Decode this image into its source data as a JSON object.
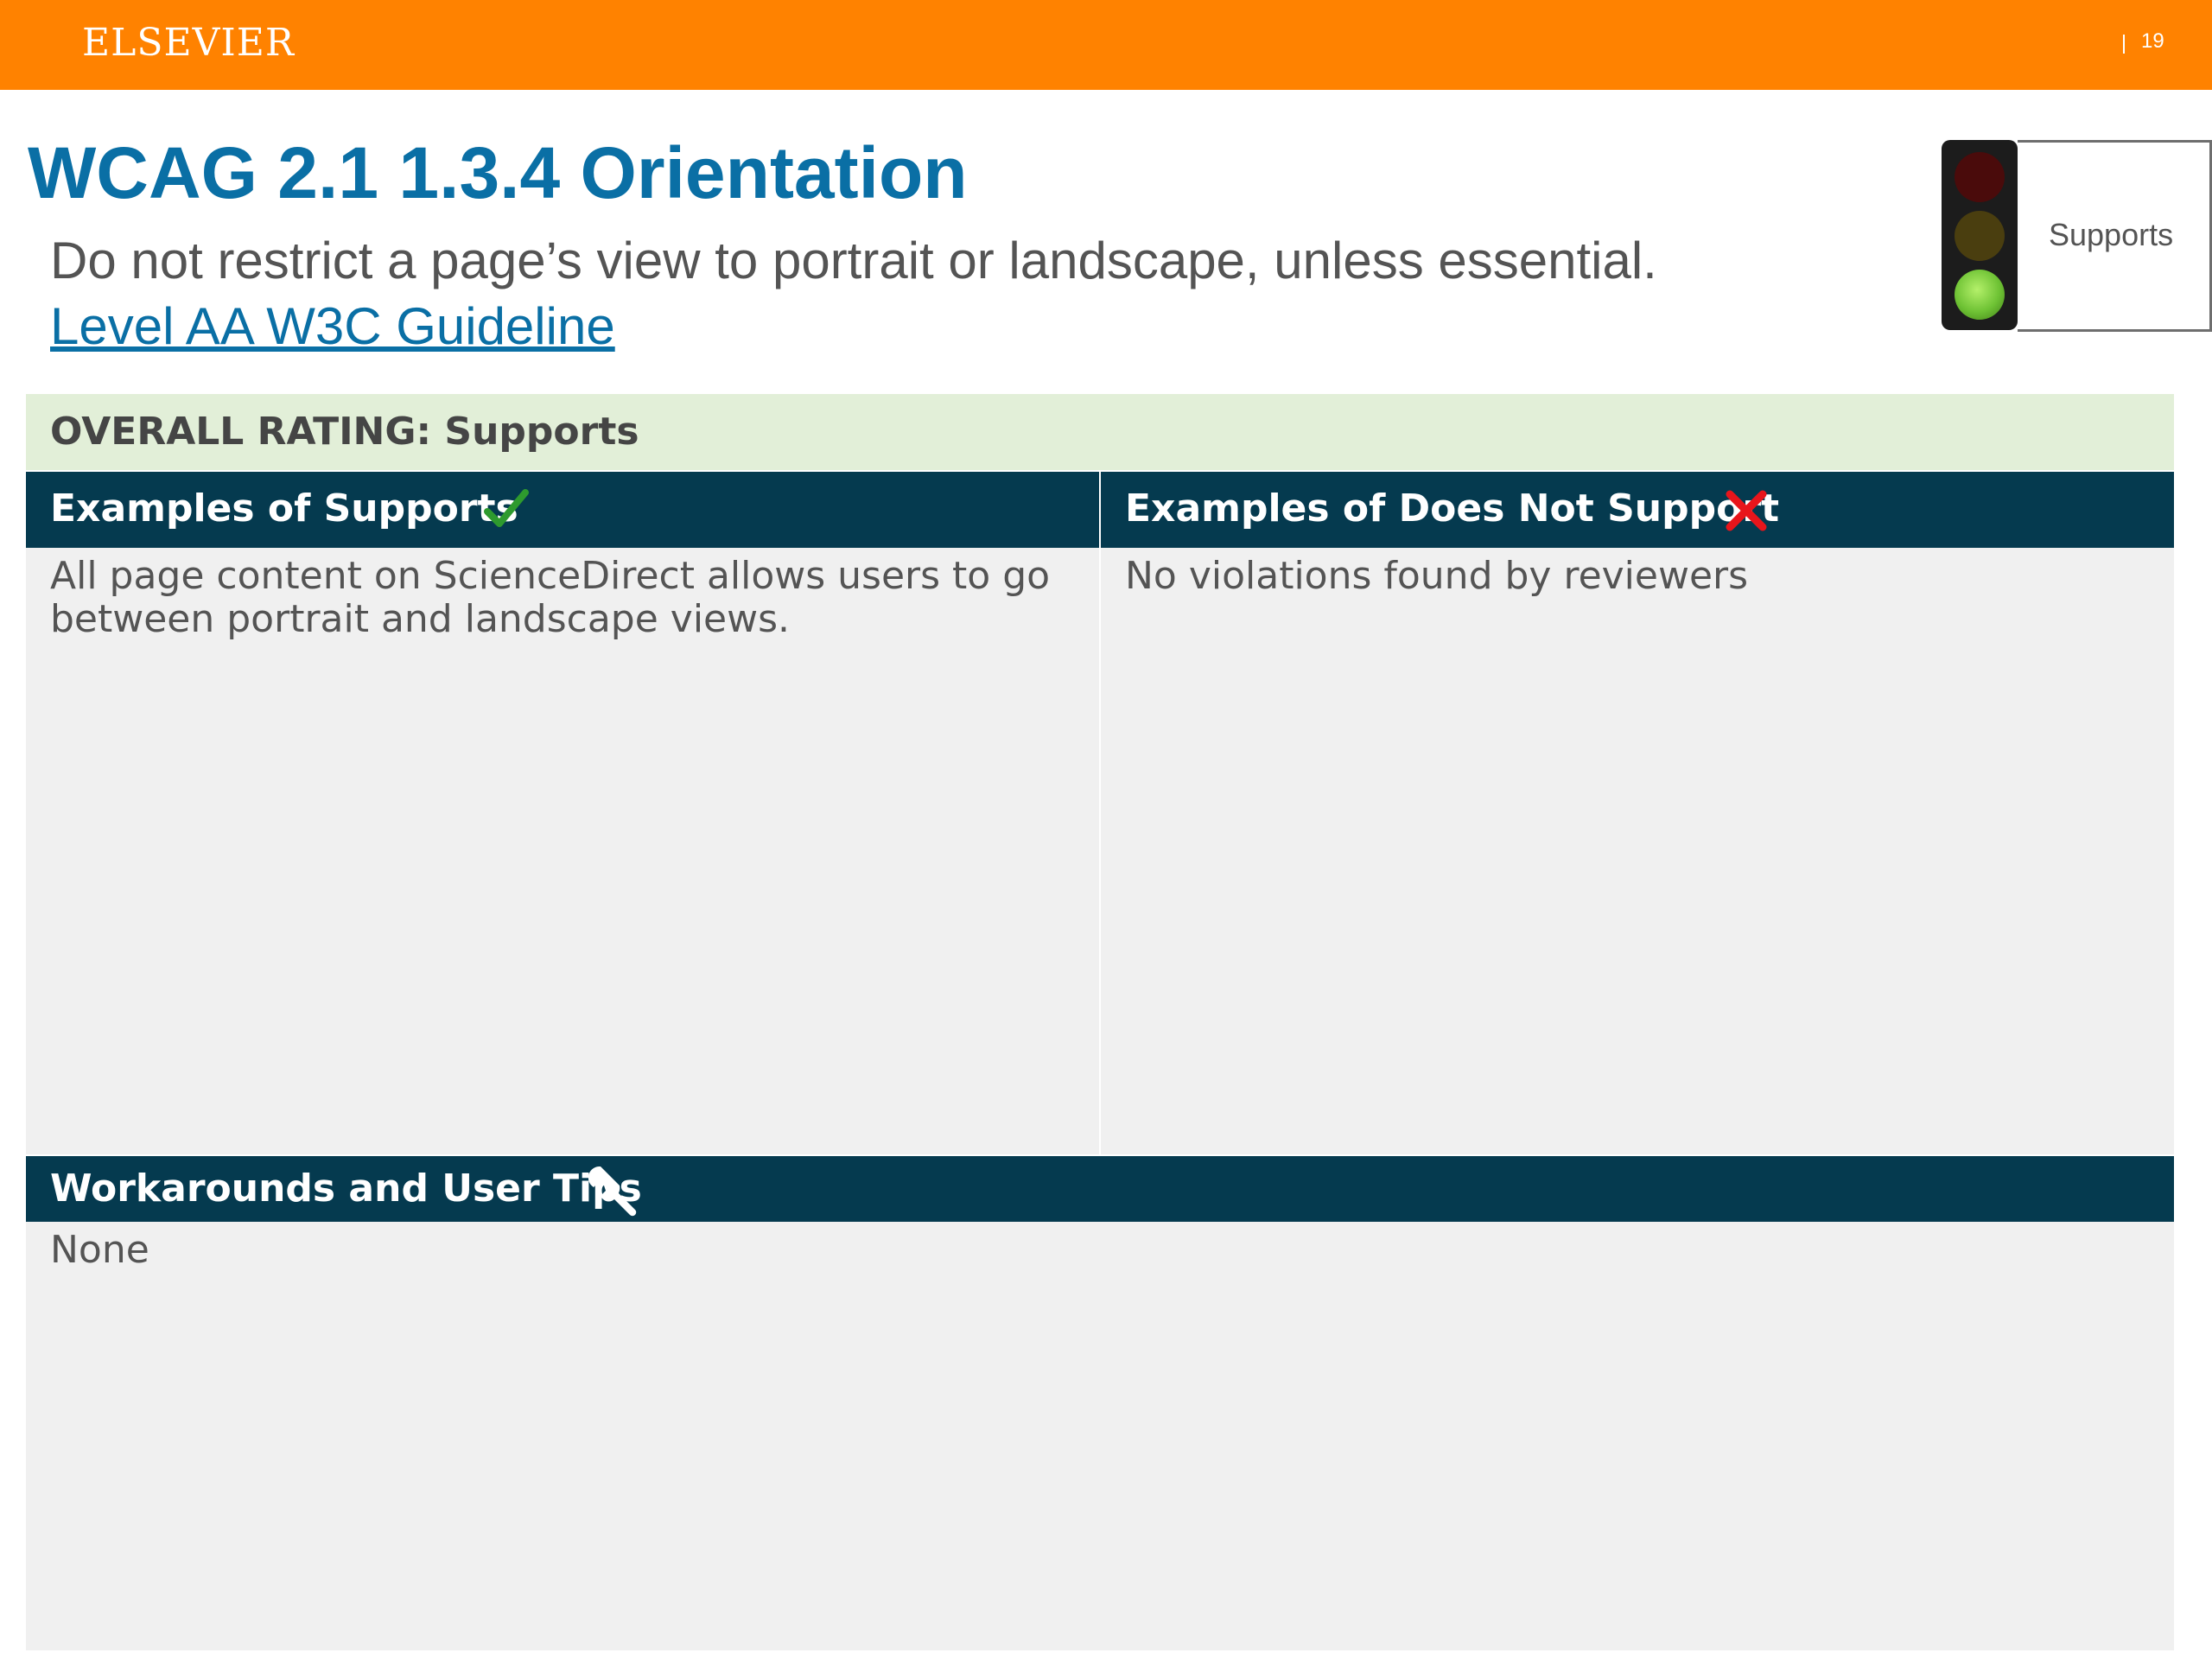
{
  "header": {
    "brand": "ELSEVIER",
    "page_number": "19",
    "bar_color": "#ff8200"
  },
  "title": "WCAG 2.1 1.3.4 Orientation",
  "subtitle": "Do not restrict a page’s view to portrait or landscape, unless essential.",
  "guideline_link": "Level AA W3C Guideline",
  "status_indicator": {
    "label": "Supports",
    "active_light": "green",
    "icon": "traffic-light-icon"
  },
  "overall_rating": "OVERALL RATING: Supports",
  "supports": {
    "heading": "Examples of Supports",
    "icon": "check-icon",
    "text": "All page content on ScienceDirect allows users to go between portrait and landscape views."
  },
  "does_not_support": {
    "heading": "Examples of Does Not Support",
    "icon": "cross-icon",
    "text": "No violations found by reviewers"
  },
  "workarounds": {
    "heading": "Workarounds and User Tips",
    "icon": "wrench-icon",
    "text": "None"
  },
  "colors": {
    "title": "#0a6fa5",
    "header_dark": "#053a4f",
    "rating_bg": "#e2efd8",
    "cell_bg": "#f0f0f0",
    "check": "#2e9a2e",
    "cross": "#e8151b"
  }
}
